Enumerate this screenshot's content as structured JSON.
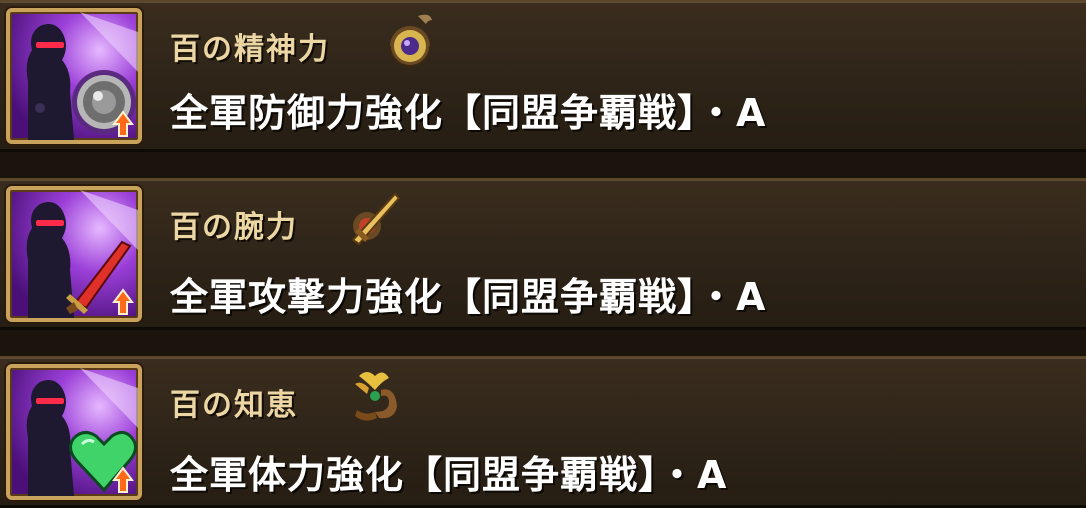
{
  "skills": [
    {
      "title": "百の精神力",
      "description": "全軍防御力強化【同盟争覇戦】・A",
      "icon": "shield-icon",
      "emblem": "shield-emblem-icon",
      "accent": "#8a8a8a"
    },
    {
      "title": "百の腕力",
      "description": "全軍攻撃力強化【同盟争覇戦】・A",
      "icon": "sword-icon",
      "emblem": "sword-emblem-icon",
      "accent": "#e0302a"
    },
    {
      "title": "百の知恵",
      "description": "全軍体力強化【同盟争覇戦】・A",
      "icon": "heart-icon",
      "emblem": "scroll-emblem-icon",
      "accent": "#3fd36a"
    }
  ],
  "colors": {
    "title": "#ecd7a4",
    "description": "#ffffff",
    "row_background": "#2e2418",
    "frame": "#c9a25c",
    "up_arrow": "#ff6a1a"
  }
}
